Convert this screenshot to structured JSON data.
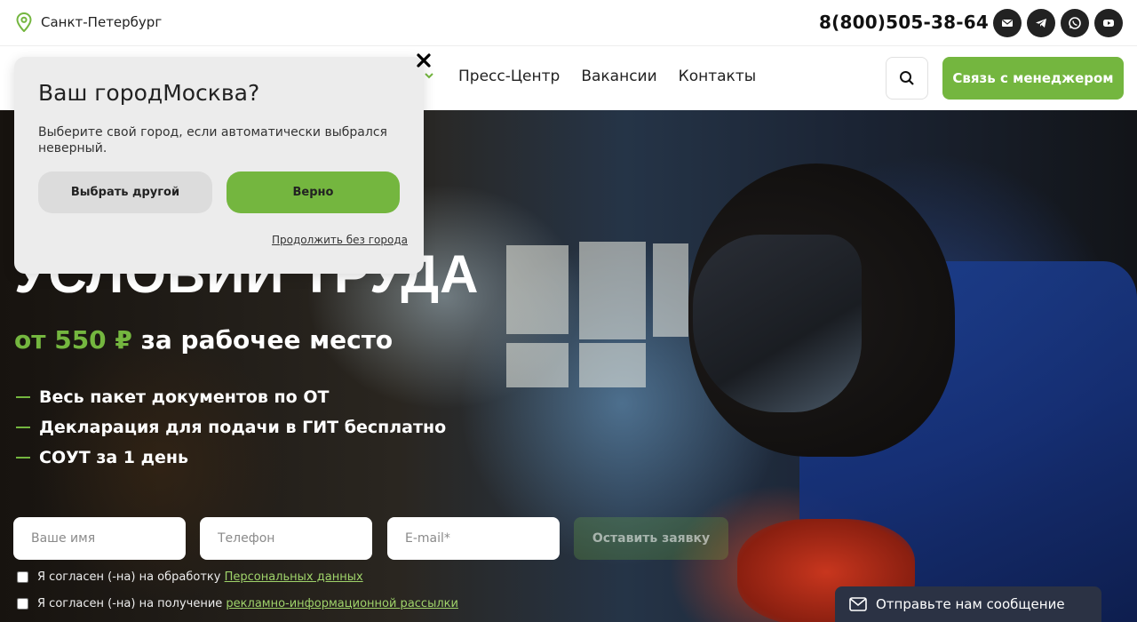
{
  "topbar": {
    "city": "Санкт-Петербург",
    "phone": "8(800)505-38-64",
    "socials": [
      {
        "icon": "mail-icon"
      },
      {
        "icon": "telegram-icon"
      },
      {
        "icon": "whatsapp-icon"
      },
      {
        "icon": "youtube-icon"
      }
    ]
  },
  "nav": {
    "links": [
      "Пресс-Центр",
      "Вакансии",
      "Контакты"
    ],
    "cta_label": "Связь с менеджером"
  },
  "hero": {
    "title": "УСЛОВИЙ ТРУДА",
    "price_prefix": "от 550 ₽",
    "price_suffix": " за рабочее место",
    "bullets": [
      "Весь пакет документов по ОТ",
      "Декларация для подачи в ГИТ бесплатно",
      "СОУТ за 1 день"
    ]
  },
  "form": {
    "name_placeholder": "Ваше имя",
    "phone_placeholder": "Телефон",
    "email_placeholder": "E-mail*",
    "submit_label": "Оставить заявку",
    "consent1_text": "Я согласен (-на) на обработку ",
    "consent1_link": "Персональных данных",
    "consent2_text": "Я согласен (-на) на получение ",
    "consent2_link": "рекламно-информационной рассылки"
  },
  "chat": {
    "label": "Отправьте нам сообщение"
  },
  "popup": {
    "title_prefix": "Ваш город",
    "title_city": "Москва?",
    "text": "Выберите свой город, если автоматически выбрался неверный.",
    "btn_other": "Выбрать другой",
    "btn_ok": "Верно",
    "skip": "Продолжить без города"
  },
  "colors": {
    "accent": "#74b63f",
    "chat_bg": "#2b3244"
  }
}
